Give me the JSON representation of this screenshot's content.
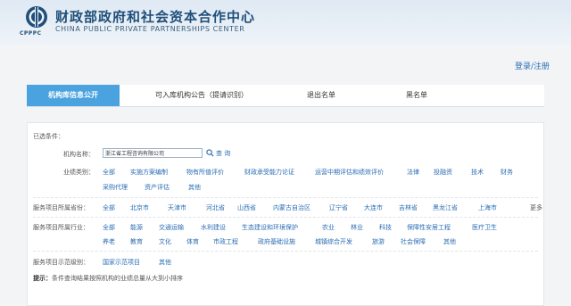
{
  "site": {
    "logo_text": "CPPPC",
    "title_cn": "财政部政府和社会资本合作中心",
    "title_en": "CHINA PUBLIC PRIVATE PARTNERSHIPS CENTER"
  },
  "account": {
    "login_label": "登录/注册"
  },
  "tabs": [
    {
      "label": "机构库信息公开",
      "active": true
    },
    {
      "label": "可入库机构公告（提请识别）"
    },
    {
      "label": "退出名单"
    },
    {
      "label": "黑名单"
    }
  ],
  "filters": {
    "selected_label": "已选条件：",
    "org_name": {
      "label": "机构名称：",
      "value": "浙江省工程咨询有限公司",
      "search_label": "查 询"
    },
    "business_category": {
      "label": "业绩类别：",
      "options": [
        "全部",
        "实施方案编制",
        "物有所值评价",
        "财政承受能力论证",
        "运营中期评估和绩效评价",
        "法律",
        "投融资",
        "技术",
        "财务",
        "采购代理",
        "资产评估",
        "其他"
      ]
    },
    "province": {
      "label": "服务项目所属省份：",
      "options": [
        "全部",
        "北京市",
        "天津市",
        "河北省",
        "山西省",
        "内蒙古自治区",
        "辽宁省",
        "大连市",
        "吉林省",
        "黑龙江省",
        "上海市"
      ],
      "more_label": "更多"
    },
    "industry": {
      "label": "服务项目所属行业：",
      "options": [
        "全部",
        "能源",
        "交通运输",
        "水利建设",
        "生态建设和环境保护",
        "农业",
        "林业",
        "科技",
        "保障性安居工程",
        "医疗卫生",
        "养老",
        "教育",
        "文化",
        "体育",
        "市政工程",
        "政府基础设施",
        "城镇综合开发",
        "旅游",
        "社会保障",
        "其他"
      ]
    },
    "demo_level": {
      "label": "服务项目示范级别：",
      "options": [
        "国家示范项目",
        "其他"
      ]
    },
    "tip": {
      "prefix": "提示：",
      "text": "条件查询结果按照机构的业绩总量从大到小排序"
    }
  },
  "colors": {
    "accent": "#4aa3df",
    "link": "#2a6db5",
    "brand": "#1f4f7a"
  }
}
